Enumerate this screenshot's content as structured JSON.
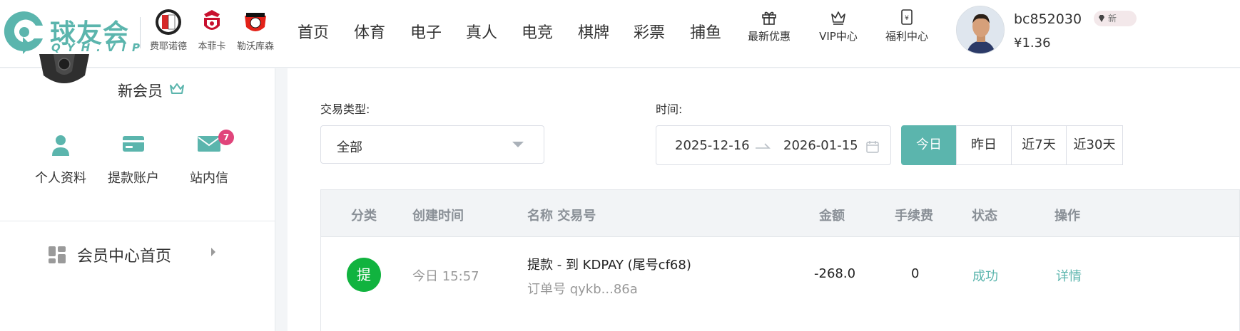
{
  "header": {
    "logo_text": "球友会",
    "logo_sub": "QYH.VIP",
    "clubs": [
      {
        "name": "费耶诺德"
      },
      {
        "name": "本菲卡"
      },
      {
        "name": "勒沃库森"
      }
    ],
    "nav": [
      "首页",
      "体育",
      "电子",
      "真人",
      "电竞",
      "棋牌",
      "彩票",
      "捕鱼"
    ],
    "links": [
      {
        "label": "最新优惠",
        "icon": "gift-icon"
      },
      {
        "label": "VIP中心",
        "icon": "crown-icon"
      },
      {
        "label": "福利中心",
        "icon": "welfare-icon"
      }
    ],
    "user": {
      "username": "bc852030",
      "balance": "¥1.36",
      "level_pill": "新"
    }
  },
  "sidebar": {
    "member_level": "新会员",
    "quick_links": [
      {
        "label": "个人资料",
        "icon": "user-icon"
      },
      {
        "label": "提款账户",
        "icon": "card-icon"
      },
      {
        "label": "站内信",
        "icon": "mail-icon",
        "badge": "7"
      }
    ],
    "menu": [
      {
        "label": "会员中心首页",
        "icon": "dashboard-icon"
      }
    ]
  },
  "filters": {
    "type_label": "交易类型:",
    "type_value": "全部",
    "time_label": "时间:",
    "date_start": "2025-12-16",
    "date_end": "2026-01-15",
    "quick_ranges": [
      "今日",
      "昨日",
      "近7天",
      "近30天"
    ],
    "active_range": "今日"
  },
  "table": {
    "columns": [
      "分类",
      "创建时间",
      "名称 交易号",
      "金额",
      "手续费",
      "状态",
      "操作"
    ],
    "rows": [
      {
        "category": "提",
        "created": "今日 15:57",
        "name": "提款 - 到 KDPAY (尾号cf68)",
        "order_no": "订单号 qykb...86a",
        "amount": "-268.0",
        "fee": "0",
        "status": "成功",
        "action": "详情"
      }
    ]
  },
  "colors": {
    "accent": "#5bb5ad",
    "badge_green": "#11b33f",
    "message_badge": "#e0457b"
  }
}
